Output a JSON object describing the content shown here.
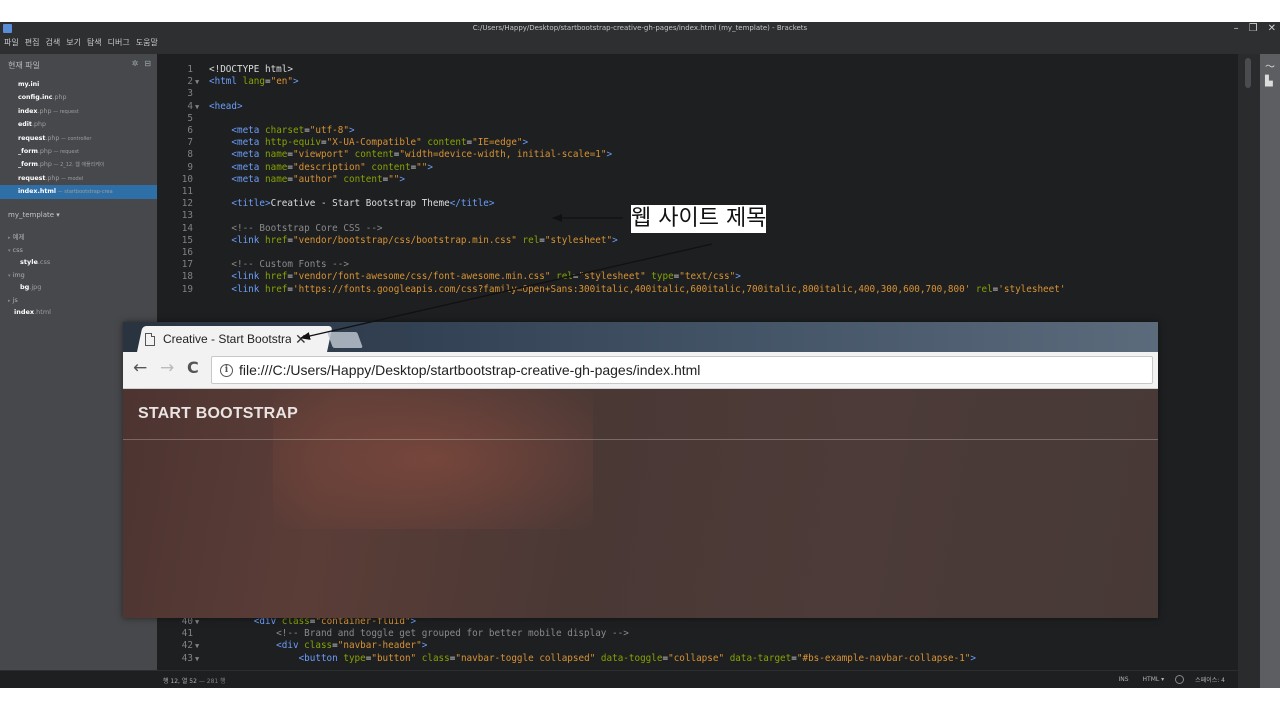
{
  "window": {
    "title": "C:/Users/Happy/Desktop/startbootstrap-creative-gh-pages/index.html (my_template) - Brackets",
    "controls": [
      "–",
      "❐",
      "✕"
    ]
  },
  "menu": [
    "파일",
    "편집",
    "검색",
    "보기",
    "탐색",
    "디버그",
    "도움말"
  ],
  "sidebar": {
    "working_files_header": "현재 파일",
    "working_files": [
      {
        "name": "my.ini",
        "desc": ""
      },
      {
        "name": "config.inc",
        "ext": ".php",
        "desc": ""
      },
      {
        "name": "index",
        "ext": ".php",
        "desc": " — request"
      },
      {
        "name": "edit",
        "ext": ".php",
        "desc": ""
      },
      {
        "name": "request",
        "ext": ".php",
        "desc": " — controller"
      },
      {
        "name": "_form",
        "ext": ".php",
        "desc": " — request"
      },
      {
        "name": "_form",
        "ext": ".php",
        "desc": " — 2_12. 웹 애플리케이"
      },
      {
        "name": "request",
        "ext": ".php",
        "desc": " — model"
      },
      {
        "name": "index.html",
        "ext": "",
        "desc": " — startbootstrap-crea"
      }
    ],
    "project_title": "my_template ▾",
    "tree": [
      {
        "arrow": "▸",
        "name": "예제",
        "ext": "",
        "indent": 8,
        "folder": true
      },
      {
        "arrow": "▾",
        "name": "css",
        "ext": "",
        "indent": 8,
        "folder": true
      },
      {
        "arrow": "",
        "name": "style",
        "ext": ".css",
        "indent": 20,
        "folder": false
      },
      {
        "arrow": "▾",
        "name": "img",
        "ext": "",
        "indent": 8,
        "folder": true
      },
      {
        "arrow": "",
        "name": "bg",
        "ext": ".jpg",
        "indent": 20,
        "folder": false
      },
      {
        "arrow": "▸",
        "name": "js",
        "ext": "",
        "indent": 8,
        "folder": true
      },
      {
        "arrow": "",
        "name": "index",
        "ext": ".html",
        "indent": 14,
        "folder": false
      }
    ]
  },
  "editor": {
    "lines": [
      {
        "n": "1",
        "fold": "",
        "tokens": [
          [
            "pl",
            "<!DOCTYPE html>"
          ]
        ]
      },
      {
        "n": "2",
        "fold": "▼",
        "tokens": [
          [
            "tg",
            "<html"
          ],
          [
            "pl",
            " "
          ],
          [
            "at",
            "lang"
          ],
          [
            "pl",
            "="
          ],
          [
            "st",
            "\"en\""
          ],
          [
            "tg",
            ">"
          ]
        ]
      },
      {
        "n": "3",
        "fold": "",
        "tokens": []
      },
      {
        "n": "4",
        "fold": "▼",
        "tokens": [
          [
            "tg",
            "<head>"
          ]
        ]
      },
      {
        "n": "5",
        "fold": "",
        "tokens": []
      },
      {
        "n": "6",
        "fold": "",
        "tokens": [
          [
            "pl",
            "    "
          ],
          [
            "tg",
            "<meta"
          ],
          [
            "pl",
            " "
          ],
          [
            "at",
            "charset"
          ],
          [
            "pl",
            "="
          ],
          [
            "st",
            "\"utf-8\""
          ],
          [
            "tg",
            ">"
          ]
        ]
      },
      {
        "n": "7",
        "fold": "",
        "tokens": [
          [
            "pl",
            "    "
          ],
          [
            "tg",
            "<meta"
          ],
          [
            "pl",
            " "
          ],
          [
            "at",
            "http-equiv"
          ],
          [
            "pl",
            "="
          ],
          [
            "st",
            "\"X-UA-Compatible\""
          ],
          [
            "pl",
            " "
          ],
          [
            "at",
            "content"
          ],
          [
            "pl",
            "="
          ],
          [
            "st",
            "\"IE=edge\""
          ],
          [
            "tg",
            ">"
          ]
        ]
      },
      {
        "n": "8",
        "fold": "",
        "tokens": [
          [
            "pl",
            "    "
          ],
          [
            "tg",
            "<meta"
          ],
          [
            "pl",
            " "
          ],
          [
            "at",
            "name"
          ],
          [
            "pl",
            "="
          ],
          [
            "st",
            "\"viewport\""
          ],
          [
            "pl",
            " "
          ],
          [
            "at",
            "content"
          ],
          [
            "pl",
            "="
          ],
          [
            "st",
            "\"width=device-width, initial-scale=1\""
          ],
          [
            "tg",
            ">"
          ]
        ]
      },
      {
        "n": "9",
        "fold": "",
        "tokens": [
          [
            "pl",
            "    "
          ],
          [
            "tg",
            "<meta"
          ],
          [
            "pl",
            " "
          ],
          [
            "at",
            "name"
          ],
          [
            "pl",
            "="
          ],
          [
            "st",
            "\"description\""
          ],
          [
            "pl",
            " "
          ],
          [
            "at",
            "content"
          ],
          [
            "pl",
            "="
          ],
          [
            "st",
            "\"\""
          ],
          [
            "tg",
            ">"
          ]
        ]
      },
      {
        "n": "10",
        "fold": "",
        "tokens": [
          [
            "pl",
            "    "
          ],
          [
            "tg",
            "<meta"
          ],
          [
            "pl",
            " "
          ],
          [
            "at",
            "name"
          ],
          [
            "pl",
            "="
          ],
          [
            "st",
            "\"author\""
          ],
          [
            "pl",
            " "
          ],
          [
            "at",
            "content"
          ],
          [
            "pl",
            "="
          ],
          [
            "st",
            "\"\""
          ],
          [
            "tg",
            ">"
          ]
        ]
      },
      {
        "n": "11",
        "fold": "",
        "tokens": []
      },
      {
        "n": "12",
        "fold": "",
        "tokens": [
          [
            "pl",
            "    "
          ],
          [
            "tg",
            "<title>"
          ],
          [
            "pl",
            "Creative - Start Bootstrap Theme"
          ],
          [
            "tg",
            "</title>"
          ]
        ]
      },
      {
        "n": "13",
        "fold": "",
        "tokens": []
      },
      {
        "n": "14",
        "fold": "",
        "tokens": [
          [
            "pl",
            "    "
          ],
          [
            "cm",
            "<!-- Bootstrap Core CSS -->"
          ]
        ]
      },
      {
        "n": "15",
        "fold": "",
        "tokens": [
          [
            "pl",
            "    "
          ],
          [
            "tg",
            "<link"
          ],
          [
            "pl",
            " "
          ],
          [
            "at",
            "href"
          ],
          [
            "pl",
            "="
          ],
          [
            "st",
            "\"vendor/bootstrap/css/bootstrap.min.css\""
          ],
          [
            "pl",
            " "
          ],
          [
            "at",
            "rel"
          ],
          [
            "pl",
            "="
          ],
          [
            "st",
            "\"stylesheet\""
          ],
          [
            "tg",
            ">"
          ]
        ]
      },
      {
        "n": "16",
        "fold": "",
        "tokens": []
      },
      {
        "n": "17",
        "fold": "",
        "tokens": [
          [
            "pl",
            "    "
          ],
          [
            "cm",
            "<!-- Custom Fonts -->"
          ]
        ]
      },
      {
        "n": "18",
        "fold": "",
        "tokens": [
          [
            "pl",
            "    "
          ],
          [
            "tg",
            "<link"
          ],
          [
            "pl",
            " "
          ],
          [
            "at",
            "href"
          ],
          [
            "pl",
            "="
          ],
          [
            "st",
            "\"vendor/font-awesome/css/font-awesome.min.css\""
          ],
          [
            "pl",
            " "
          ],
          [
            "at",
            "rel"
          ],
          [
            "pl",
            "="
          ],
          [
            "st",
            "\"stylesheet\""
          ],
          [
            "pl",
            " "
          ],
          [
            "at",
            "type"
          ],
          [
            "pl",
            "="
          ],
          [
            "st",
            "\"text/css\""
          ],
          [
            "tg",
            ">"
          ]
        ]
      },
      {
        "n": "19",
        "fold": "",
        "tokens": [
          [
            "pl",
            "    "
          ],
          [
            "tg",
            "<link"
          ],
          [
            "pl",
            " "
          ],
          [
            "at",
            "href"
          ],
          [
            "pl",
            "="
          ],
          [
            "st",
            "'https://fonts.googleapis.com/css?family=Open+Sans:300italic,400italic,600italic,700italic,800italic,400,300,600,700,800'"
          ],
          [
            "pl",
            " "
          ],
          [
            "at",
            "rel"
          ],
          [
            "pl",
            "="
          ],
          [
            "st",
            "'stylesheet'"
          ]
        ]
      },
      {
        "n": "40",
        "fold": "▼",
        "tokens": [
          [
            "pl",
            "        "
          ],
          [
            "tg",
            "<div"
          ],
          [
            "pl",
            " "
          ],
          [
            "at",
            "class"
          ],
          [
            "pl",
            "="
          ],
          [
            "st",
            "\"container-fluid\""
          ],
          [
            "tg",
            ">"
          ]
        ]
      },
      {
        "n": "41",
        "fold": "",
        "tokens": [
          [
            "pl",
            "            "
          ],
          [
            "cm",
            "<!-- Brand and toggle get grouped for better mobile display -->"
          ]
        ]
      },
      {
        "n": "42",
        "fold": "▼",
        "tokens": [
          [
            "pl",
            "            "
          ],
          [
            "tg",
            "<div"
          ],
          [
            "pl",
            " "
          ],
          [
            "at",
            "class"
          ],
          [
            "pl",
            "="
          ],
          [
            "st",
            "\"navbar-header\""
          ],
          [
            "tg",
            ">"
          ]
        ]
      },
      {
        "n": "43",
        "fold": "▼",
        "tokens": [
          [
            "pl",
            "                "
          ],
          [
            "tg",
            "<button"
          ],
          [
            "pl",
            " "
          ],
          [
            "at",
            "type"
          ],
          [
            "pl",
            "="
          ],
          [
            "st",
            "\"button\""
          ],
          [
            "pl",
            " "
          ],
          [
            "at",
            "class"
          ],
          [
            "pl",
            "="
          ],
          [
            "st",
            "\"navbar-toggle collapsed\""
          ],
          [
            "pl",
            " "
          ],
          [
            "at",
            "data-toggle"
          ],
          [
            "pl",
            "="
          ],
          [
            "st",
            "\"collapse\""
          ],
          [
            "pl",
            " "
          ],
          [
            "at",
            "data-target"
          ],
          [
            "pl",
            "="
          ],
          [
            "st",
            "\"#bs-example-navbar-collapse-1\""
          ],
          [
            "tg",
            ">"
          ]
        ]
      }
    ]
  },
  "statusbar": {
    "cursor": "행 12, 열 52",
    "lines": " — 281 행",
    "ins": "INS",
    "mode": "HTML ▾",
    "spaces": "스페이스: 4"
  },
  "browser": {
    "tab_title": "Creative - Start Bootstrap Theme",
    "tab_close": "✕",
    "nav_back": "←",
    "nav_forward": "→",
    "nav_reload": "C",
    "info_icon": "i",
    "url": "file:///C:/Users/Happy/Desktop/startbootstrap-creative-gh-pages/index.html",
    "brand": "START BOOTSTRAP"
  },
  "annotation": {
    "label": "웹 사이트 제목"
  },
  "colors": {
    "editor_bg": "#1e1f21",
    "sidebar_bg": "#47484b",
    "tag": "#6c9ef8",
    "attr": "#85a300",
    "string": "#d89333",
    "comment": "#8a8a8a",
    "active_file": "#2f6fa7"
  },
  "icons": {
    "app": "brackets-app-icon",
    "settings": "gear-icon",
    "split": "split-view-icon",
    "live_preview": "live-preview-icon",
    "extensions": "extension-manager-icon"
  }
}
